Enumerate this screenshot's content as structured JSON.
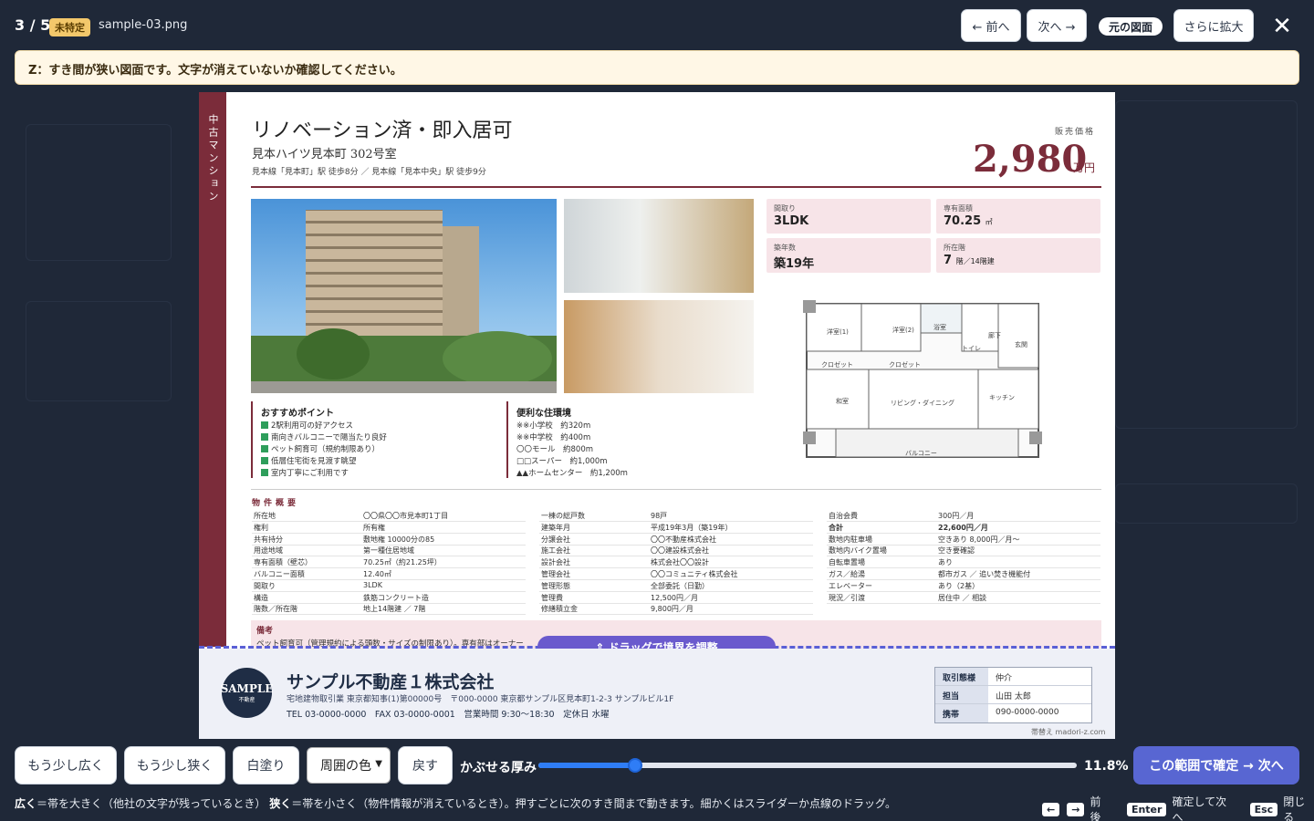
{
  "topbar": {
    "counter": "3 / 5",
    "badge": "未特定",
    "filename": "sample-03.png",
    "prev_label": "← 前へ",
    "next_label": "次へ →",
    "original_label": "元の図面",
    "zoom_label": "さらに拡大",
    "close_label": "✕"
  },
  "warning": "Z：すき間が狭い図面です。文字が消えていないか確認してください。",
  "flyer": {
    "sidebar": "中古マンション",
    "title": "リノベーション済・即入居可",
    "subtitle": "見本ハイツ見本町 302号室",
    "access": "見本線「見本町」駅 徒歩8分 ／ 見本線「見本中央」駅 徒歩9分",
    "price_label": "販売価格",
    "price": "2,980",
    "price_unit": "万円",
    "info": [
      {
        "key": "間取り",
        "value": "3LDK",
        "unit": ""
      },
      {
        "key": "専有面積",
        "value": "70.25",
        "unit": "㎡"
      },
      {
        "key": "築年数",
        "value": "築19年",
        "unit": ""
      },
      {
        "key": "所在階",
        "value": "7",
        "unit": "階／14階建"
      }
    ],
    "plan_labels": {
      "bed1": "洋室(1)",
      "bed2": "洋室(2)",
      "bath": "浴室",
      "toilet": "トイレ",
      "hall": "廊下",
      "entrance": "玄関",
      "closet1": "クロゼット",
      "closet2": "クロゼット",
      "washitsu": "和室",
      "living": "リビング・ダイニング",
      "kitchen": "キッチン",
      "balcony": "バルコニー"
    },
    "points_title": "おすすめポイント",
    "points": [
      "2駅利用可の好アクセス",
      "南向きバルコニーで陽当たり良好",
      "ペット飼育可（規約制限あり）",
      "低層住宅街を見渡す眺望",
      "室内丁寧にご利用です"
    ],
    "env_title": "便利な住環境",
    "env": [
      "※※小学校　約320m",
      "※※中学校　約400m",
      "〇〇モール　約800m",
      "□□スーパー　約1,000m",
      "▲▲ホームセンター　約1,200m"
    ],
    "spec_title": "物件概要",
    "spec_col1": [
      [
        "所在地",
        "〇〇県〇〇市見本町1丁目"
      ],
      [
        "権利",
        "所有権"
      ],
      [
        "共有持分",
        "敷地権 10000分の85"
      ],
      [
        "用途地域",
        "第一種住居地域"
      ],
      [
        "専有面積（壁芯）",
        "70.25㎡（約21.25坪）"
      ],
      [
        "バルコニー面積",
        "12.40㎡"
      ],
      [
        "間取り",
        "3LDK"
      ],
      [
        "構造",
        "鉄筋コンクリート造"
      ],
      [
        "階数／所在階",
        "地上14階建 ／ 7階"
      ]
    ],
    "spec_col2": [
      [
        "一棟の総戸数",
        "98戸"
      ],
      [
        "建築年月",
        "平成19年3月（築19年）"
      ],
      [
        "分譲会社",
        "〇〇不動産株式会社"
      ],
      [
        "施工会社",
        "〇〇建設株式会社"
      ],
      [
        "設計会社",
        "株式会社〇〇設計"
      ],
      [
        "管理会社",
        "〇〇コミュニティ株式会社"
      ],
      [
        "管理形態",
        "全部委託（日勤）"
      ],
      [
        "管理費",
        "12,500円／月"
      ],
      [
        "修繕積立金",
        "9,800円／月"
      ]
    ],
    "spec_col3": [
      [
        "自治会費",
        "300円／月"
      ],
      [
        "合計",
        "22,600円／月"
      ],
      [
        "敷地内駐車場",
        "空きあり 8,000円／月〜"
      ],
      [
        "敷地内バイク置場",
        "空き要確認"
      ],
      [
        "自転車置場",
        "あり"
      ],
      [
        "ガス／給湯",
        "都市ガス ／ 追い焚き機能付"
      ],
      [
        "エレベーター",
        "あり（2基）"
      ],
      [
        "現況／引渡",
        "居住中 ／ 相談"
      ]
    ],
    "remarks_title": "備考",
    "remarks": "ペット飼育可（管理規約による頭数・サイズの制限あり）。専有部はオーナー"
  },
  "drag_handle": "⇕ ドラッグで境界を調整",
  "company": {
    "logo_main": "SAMPLE",
    "logo_sub": "不動産",
    "name": "サンプル不動産１株式会社",
    "license": "宅地建物取引業 東京都知事(1)第00000号　〒000-0000 東京都サンプル区見本町1-2-3 サンプルビル1F",
    "contact": "TEL 03-0000-0000　FAX 03-0000-0001　営業時間 9:30〜18:30　定休日 水曜",
    "table": [
      [
        "取引態様",
        "仲介"
      ],
      [
        "担当",
        "山田 太郎"
      ],
      [
        "携帯",
        "090-0000-0000"
      ]
    ],
    "credit": "帯替え madori-z.com"
  },
  "controls": {
    "wider": "もう少し広く",
    "narrower": "もう少し狭く",
    "whiteout": "白塗り",
    "color_select": "周囲の色",
    "back": "戻す",
    "thickness_label": "かぶせる厚み",
    "thickness_percent": "11.8%",
    "thickness_value": 0.18,
    "confirm": "この範囲で確定 → 次へ"
  },
  "help": {
    "wide_key": "広く",
    "wide_text": "＝帯を大きく（他社の文字が残っているとき）",
    "narrow_key": "狭く",
    "narrow_text": "＝帯を小さく（物件情報が消えているとき）。押すごとに次のすき間まで動きます。細かくはスライダーか点線のドラッグ。",
    "key_left": "←",
    "key_right": "→",
    "nav_text": "前後",
    "enter_key": "Enter",
    "enter_text": "確定して次へ",
    "esc_key": "Esc",
    "esc_text": "閉じる"
  }
}
